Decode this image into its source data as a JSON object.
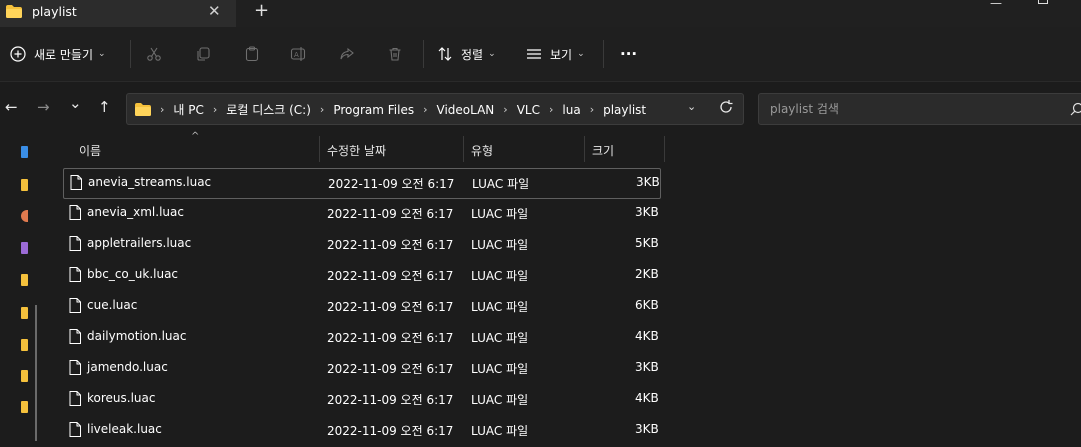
{
  "tab": {
    "title": "playlist",
    "close": "✕",
    "new_tab": "+"
  },
  "toolbar": {
    "new_label": "새로 만들기",
    "sort_label": "정렬",
    "view_label": "보기",
    "more_label": "···"
  },
  "nav": {
    "back": "←",
    "forward": "→",
    "recent": "⌄",
    "up": "↑"
  },
  "breadcrumb": [
    "내 PC",
    "로컬 디스크 (C:)",
    "Program Files",
    "VideoLAN",
    "VLC",
    "lua",
    "playlist"
  ],
  "search": {
    "placeholder": "playlist 검색"
  },
  "columns": {
    "name": "이름",
    "date": "수정한 날짜",
    "type": "유형",
    "size": "크기"
  },
  "files": [
    {
      "name": "anevia_streams.luac",
      "date": "2022-11-09 오전 6:17",
      "type": "LUAC 파일",
      "size": "3KB"
    },
    {
      "name": "anevia_xml.luac",
      "date": "2022-11-09 오전 6:17",
      "type": "LUAC 파일",
      "size": "3KB"
    },
    {
      "name": "appletrailers.luac",
      "date": "2022-11-09 오전 6:17",
      "type": "LUAC 파일",
      "size": "5KB"
    },
    {
      "name": "bbc_co_uk.luac",
      "date": "2022-11-09 오전 6:17",
      "type": "LUAC 파일",
      "size": "2KB"
    },
    {
      "name": "cue.luac",
      "date": "2022-11-09 오전 6:17",
      "type": "LUAC 파일",
      "size": "6KB"
    },
    {
      "name": "dailymotion.luac",
      "date": "2022-11-09 오전 6:17",
      "type": "LUAC 파일",
      "size": "4KB"
    },
    {
      "name": "jamendo.luac",
      "date": "2022-11-09 오전 6:17",
      "type": "LUAC 파일",
      "size": "3KB"
    },
    {
      "name": "koreus.luac",
      "date": "2022-11-09 오전 6:17",
      "type": "LUAC 파일",
      "size": "4KB"
    },
    {
      "name": "liveleak.luac",
      "date": "2022-11-09 오전 6:17",
      "type": "LUAC 파일",
      "size": "3KB"
    }
  ],
  "colors": {
    "folder": "#f5c13c",
    "accent": "#4aa3f0",
    "background": "#1c1c1c"
  }
}
